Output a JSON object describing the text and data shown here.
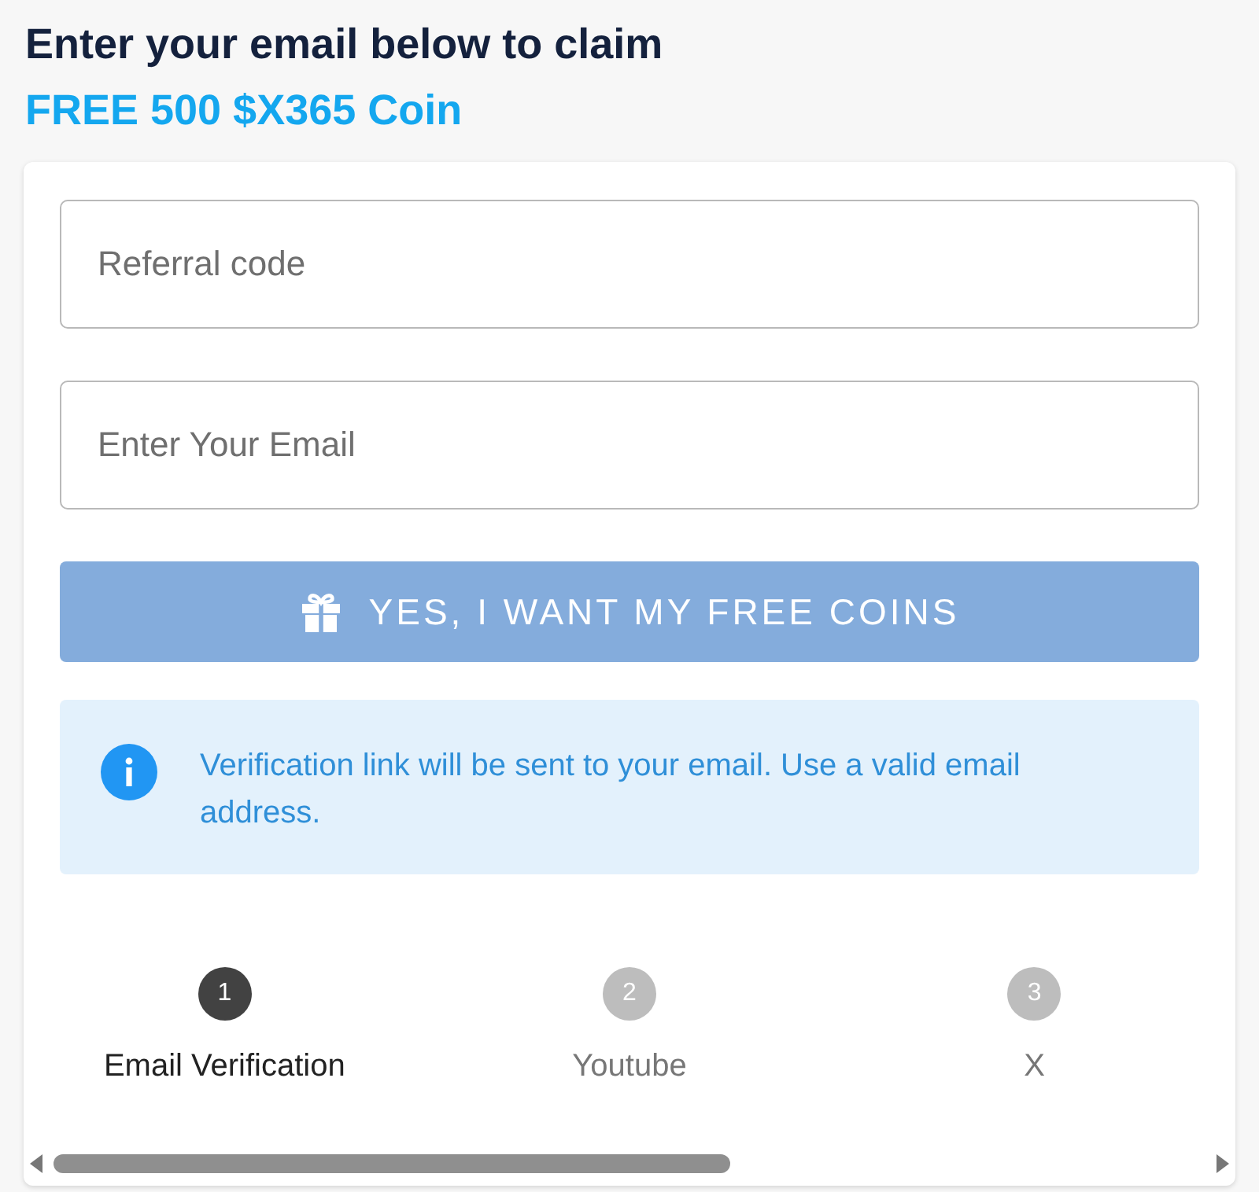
{
  "heading": "Enter your email below to claim",
  "offer": "FREE 500 $X365 Coin",
  "fields": [
    {
      "placeholder": "Referral code"
    },
    {
      "placeholder": "Enter Your Email"
    }
  ],
  "submit_button": "YES, I WANT MY FREE COINS",
  "notice": "Verification link will be sent to your email. Use a valid email address.",
  "steps": [
    {
      "number": "1",
      "label": "Email Verification",
      "selected": true
    },
    {
      "number": "2",
      "label": "Youtube",
      "selected": false
    },
    {
      "number": "3",
      "label": "X",
      "selected": false
    }
  ]
}
